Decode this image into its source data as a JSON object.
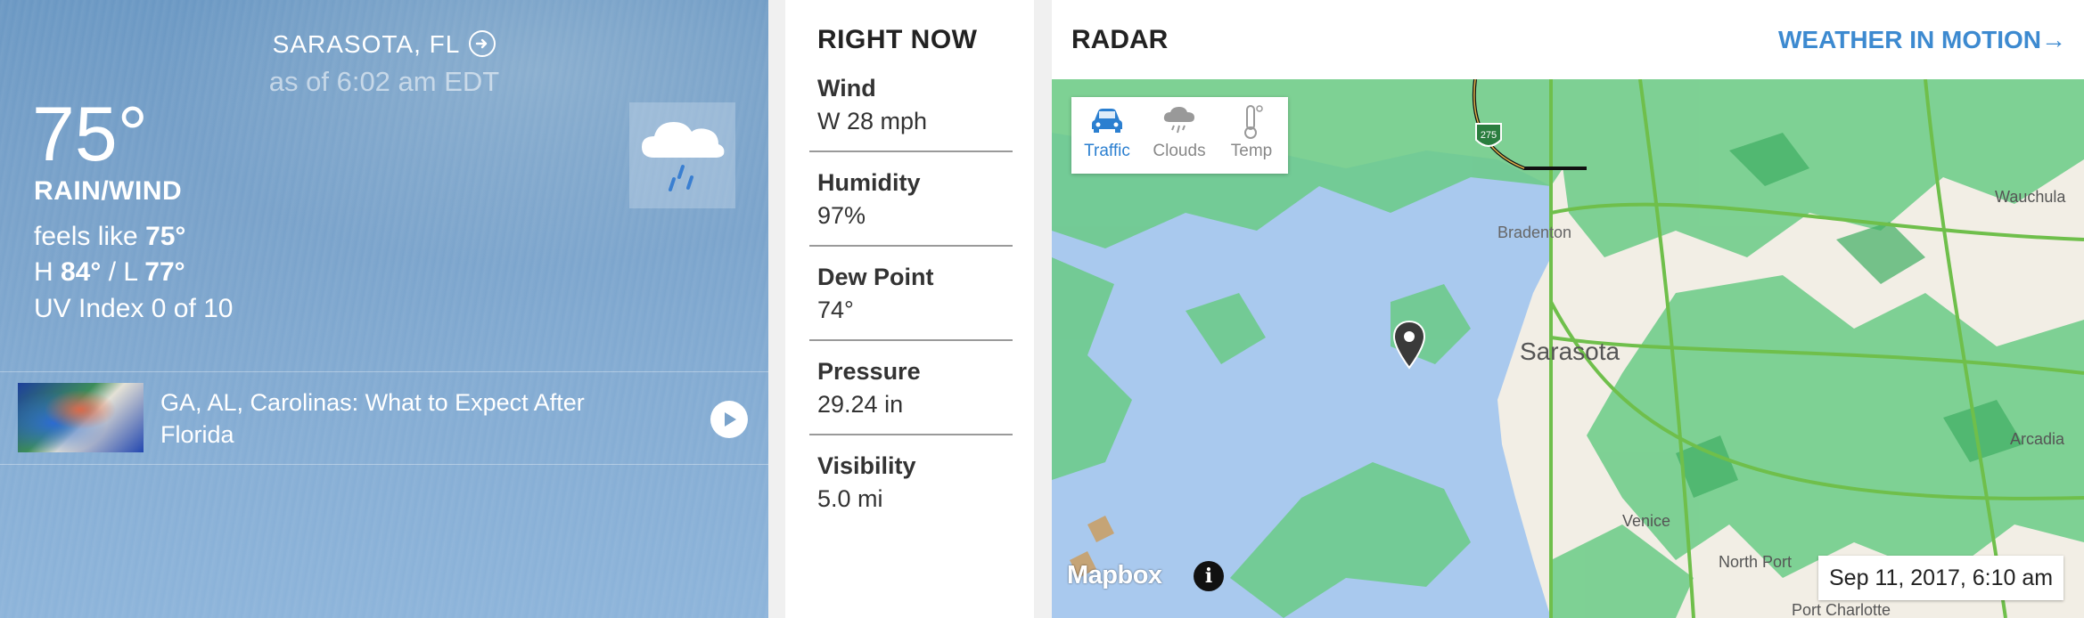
{
  "current": {
    "location": "SARASOTA, FL",
    "as_of": "as of 6:02 am EDT",
    "temperature": "75°",
    "phrase": "RAIN/WIND",
    "feels_like_label": "feels like ",
    "feels_like_value": "75°",
    "high_label": "H ",
    "high_value": "84°",
    "low_sep": " / L ",
    "low_value": "77°",
    "uv_index": "UV Index 0 of 10",
    "icon": "rain-wind-cloud-icon",
    "video": {
      "title": "GA, AL, Carolinas: What to Expect After Florida"
    }
  },
  "right_now": {
    "title": "RIGHT NOW",
    "items": [
      {
        "label": "Wind",
        "value": "W 28 mph"
      },
      {
        "label": "Humidity",
        "value": "97%"
      },
      {
        "label": "Dew Point",
        "value": "74°"
      },
      {
        "label": "Pressure",
        "value": "29.24 in"
      },
      {
        "label": "Visibility",
        "value": "5.0 mi"
      }
    ]
  },
  "radar": {
    "title": "RADAR",
    "link": "WEATHER IN MOTION→",
    "layers": [
      {
        "label": "Traffic",
        "icon": "car-icon",
        "active": true
      },
      {
        "label": "Clouds",
        "icon": "cloud-rain-icon",
        "active": false
      },
      {
        "label": "Temp",
        "icon": "thermometer-icon",
        "active": false
      }
    ],
    "map_labels": {
      "bradenton": "Bradenton",
      "sarasota": "Sarasota",
      "venice": "Venice",
      "north_port": "North Port",
      "port_charlotte": "Port Charlotte",
      "wauchula": "Wauchula",
      "arcadia": "Arcadia",
      "shield": "275"
    },
    "attribution": "Mapbox",
    "info": "i",
    "timestamp": "Sep 11, 2017, 6:10 am"
  },
  "colors": {
    "accent": "#3d8ad0",
    "radar_green": "#5cc77e",
    "water": "#a9c9ee",
    "land": "#f2eee5"
  }
}
